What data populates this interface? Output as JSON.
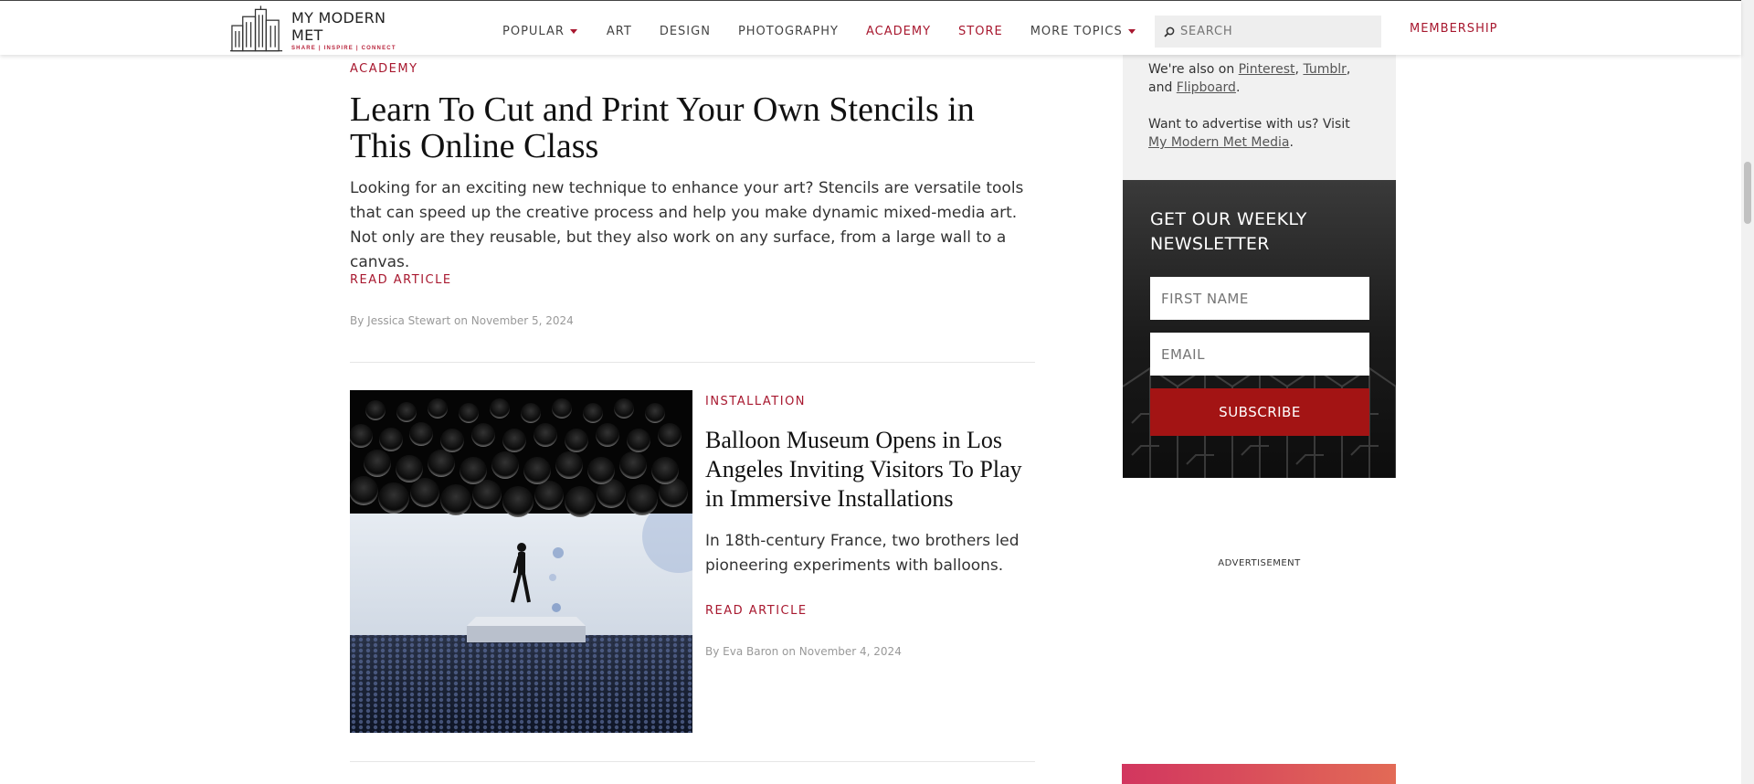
{
  "header": {
    "logo_name": "MY MODERN MET",
    "logo_tagline": "SHARE | INSPIRE | CONNECT",
    "nav": [
      {
        "label": "POPULAR",
        "dropdown": true
      },
      {
        "label": "ART"
      },
      {
        "label": "DESIGN"
      },
      {
        "label": "PHOTOGRAPHY"
      },
      {
        "label": "ACADEMY",
        "highlight": true
      },
      {
        "label": "STORE",
        "highlight": true
      },
      {
        "label": "MORE TOPICS",
        "dropdown": true
      }
    ],
    "search_placeholder": "SEARCH",
    "membership": "MEMBERSHIP",
    "accent_color": "#a8182f"
  },
  "articles": [
    {
      "category": "ACADEMY",
      "title": "Learn To Cut and Print Your Own Stencils in This Online Class",
      "excerpt": "Looking for an exciting new technique to enhance your art? Stencils are versatile tools that can speed up the creative process and help you make dynamic mixed-media art. Not only are they reusable, but they also work on any surface, from a large wall to a canvas.",
      "read_more": "READ ARTICLE",
      "byline": "By Jessica Stewart on November 5, 2024"
    },
    {
      "category": "INSTALLATION",
      "title": "Balloon Museum Opens in Los Angeles Inviting Visitors To Play in Immersive Installations",
      "excerpt": "In 18th-century France, two brothers led pioneering experiments with balloons.",
      "read_more": "READ ARTICLE",
      "byline": "By Eva Baron on November 4, 2024"
    }
  ],
  "sidebar": {
    "social_prefix": "We're also on",
    "social_links": [
      "Pinterest",
      "Tumblr",
      "Flipboard"
    ],
    "social_and": "and",
    "advertise_text": "Want to advertise with us? Visit",
    "advertise_link": "My Modern Met Media",
    "newsletter": {
      "title": "GET OUR WEEKLY NEWSLETTER",
      "first_name_placeholder": "FIRST NAME",
      "email_placeholder": "EMAIL",
      "subscribe": "SUBSCRIBE",
      "button_color": "#a31414"
    },
    "ad_label": "ADVERTISEMENT"
  }
}
